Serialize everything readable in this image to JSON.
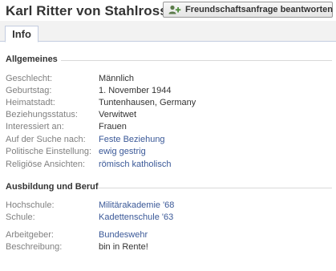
{
  "profile": {
    "name": "Karl Ritter von Stahlross",
    "friend_request_label": "Freundschaftsanfrage beantworten"
  },
  "tabs": [
    {
      "label": "Info",
      "active": true
    }
  ],
  "sections": {
    "general": {
      "title": "Allgemeines",
      "rows": [
        {
          "label": "Geschlecht:",
          "value": "Männlich",
          "link": false
        },
        {
          "label": "Geburtstag:",
          "value": "1. November 1944",
          "link": false
        },
        {
          "label": "Heimatstadt:",
          "value": "Tuntenhausen, Germany",
          "link": false
        },
        {
          "label": "Beziehungsstatus:",
          "value": "Verwitwet",
          "link": false
        },
        {
          "label": "Interessiert an:",
          "value": "Frauen",
          "link": false
        },
        {
          "label": "Auf der Suche nach:",
          "value": "Feste Beziehung",
          "link": true
        },
        {
          "label": "Politische Einstellung:",
          "value": "ewig gestrig",
          "link": true
        },
        {
          "label": "Religiöse Ansichten:",
          "value": "römisch katholisch",
          "link": true
        }
      ]
    },
    "education": {
      "title": "Ausbildung und Beruf",
      "rows": [
        {
          "label": "Hochschule:",
          "value": "Militärakademie '68",
          "link": true
        },
        {
          "label": "Schule:",
          "value": "Kadettenschule '63",
          "link": true
        },
        {
          "label": "Arbeitgeber:",
          "value": "Bundeswehr",
          "link": true
        },
        {
          "label": "Beschreibung:",
          "value": "bin in Rente!",
          "link": false
        }
      ]
    }
  },
  "colors": {
    "link": "#3b5998",
    "label": "#808080",
    "text": "#333333",
    "tab_bar": "#f2f2f2"
  }
}
